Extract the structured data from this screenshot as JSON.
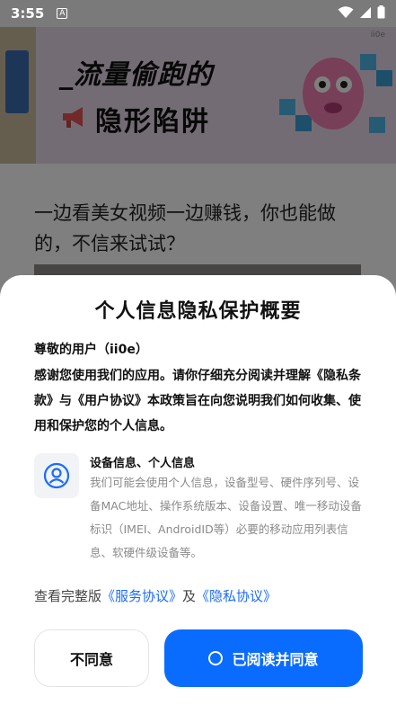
{
  "status_bar": {
    "time": "3:55",
    "notification_badge": "A",
    "icons": [
      "wifi-icon",
      "cellular-icon",
      "battery-icon"
    ]
  },
  "background_page": {
    "banner": {
      "title_line1": "_流量偷跑的",
      "title_line2": "隐形陷阱",
      "watermark": "ii0e"
    },
    "article_title": "一边看美女视频一边赚钱，你也能做的，不信来试试？"
  },
  "dialog": {
    "title": "个人信息隐私保护概要",
    "greeting": "尊敬的用户（ii0e）",
    "intro": "感谢您使用我们的应用。请你仔细充分阅读并理解《隐私条款》与《用户协议》本政策旨在向您说明我们如何收集、使用和保护您的个人信息。",
    "info": {
      "icon": "user-profile-icon",
      "heading": "设备信息、个人信息",
      "text": "我们可能会使用个人信息，设备型号、硬件序列号、设备MAC地址、操作系统版本、设备设置、唯一移动设备标识（IMEI、AndroidID等）必要的移动应用列表信息、软硬件级设备等。"
    },
    "links": {
      "prefix": "查看完整版",
      "service": "《服务协议》",
      "and": "及",
      "privacy": "《隐私协议》"
    },
    "buttons": {
      "decline": "不同意",
      "agree": "已阅读并同意"
    }
  },
  "colors": {
    "accent": "#0a6cff",
    "status_bar": "#7a7a7a",
    "scrim": "rgba(0,0,0,0.5)"
  }
}
